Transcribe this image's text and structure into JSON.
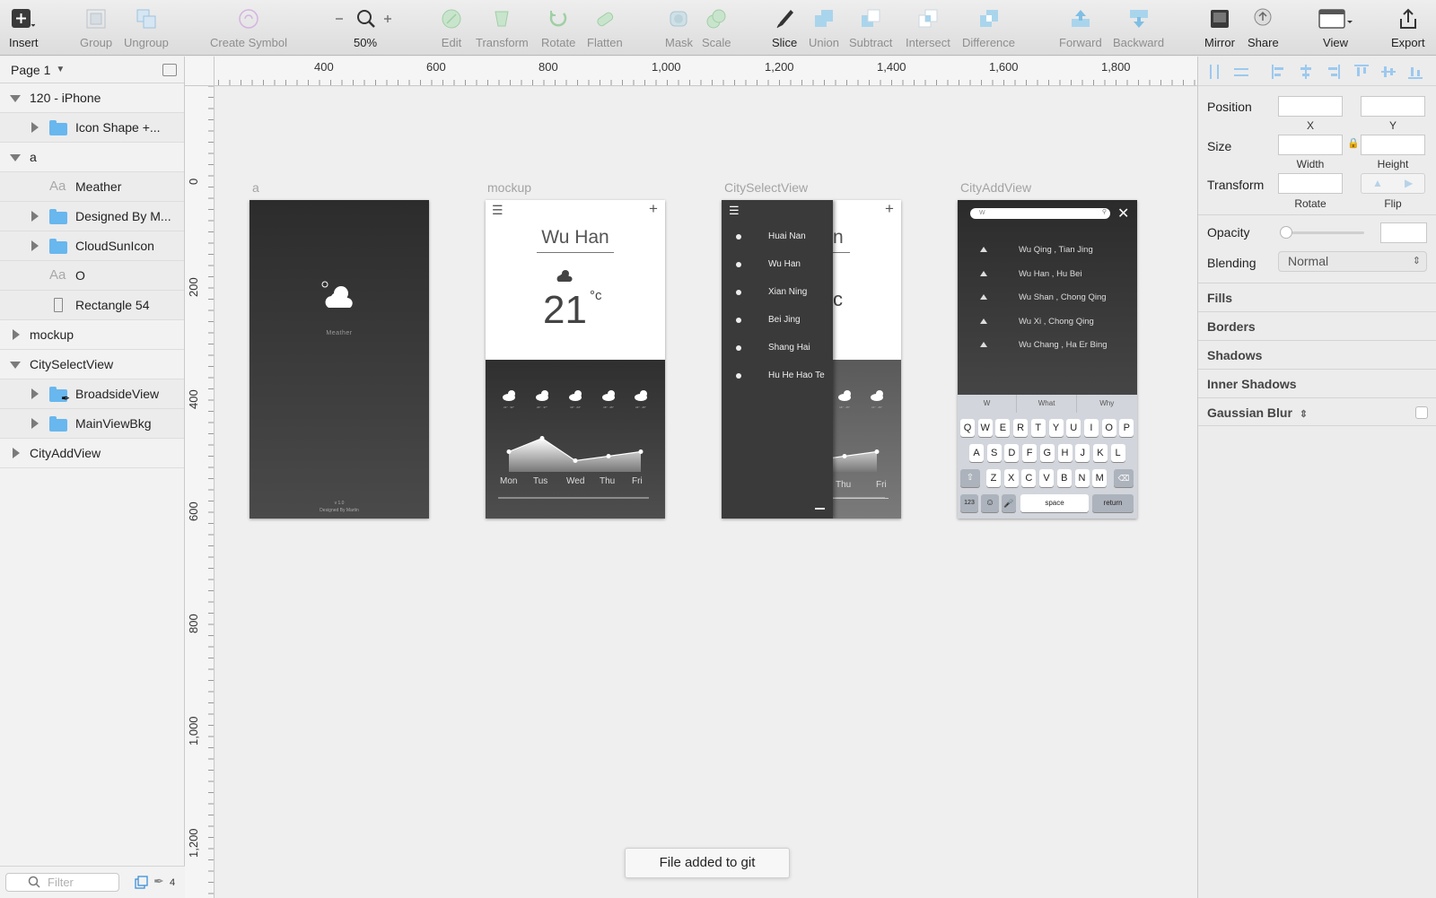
{
  "toolbar": {
    "insert": "Insert",
    "group": "Group",
    "ungroup": "Ungroup",
    "create_symbol": "Create Symbol",
    "zoom": "50%",
    "edit": "Edit",
    "transform": "Transform",
    "rotate": "Rotate",
    "flatten": "Flatten",
    "mask": "Mask",
    "scale": "Scale",
    "slice": "Slice",
    "union": "Union",
    "subtract": "Subtract",
    "intersect": "Intersect",
    "difference": "Difference",
    "forward": "Forward",
    "backward": "Backward",
    "mirror": "Mirror",
    "share": "Share",
    "view": "View",
    "export": "Export"
  },
  "layers_panel": {
    "page": "Page 1",
    "layers": [
      "120 - iPhone",
      "Icon Shape +...",
      "a",
      "Meather",
      "Designed By M...",
      "CloudSunIcon",
      "O",
      "Rectangle 54",
      "mockup",
      "CitySelectView",
      "BroadsideView",
      "MainViewBkg",
      "CityAddView"
    ],
    "filter_placeholder": "Filter",
    "edited_count": "4"
  },
  "rulers": {
    "horizontal": [
      "400",
      "600",
      "800",
      "1,000",
      "1,200",
      "1,400",
      "1,600",
      "1,800"
    ],
    "vertical": [
      "0",
      "200",
      "400",
      "600",
      "800",
      "1,000",
      "1,200"
    ]
  },
  "canvas": {
    "artboards": {
      "a": {
        "title": "a",
        "app_name": "Meather",
        "version": "v 1.0",
        "designer": "Designed By Martin"
      },
      "mockup": {
        "title": "mockup",
        "city": "Wu Han",
        "temperature": "21",
        "unit": "°c",
        "days": [
          "Mon",
          "Tus",
          "Wed",
          "Thu",
          "Fri"
        ],
        "forecast_temps": [
          "21° · 32°",
          "24° · 37°",
          "19° · 24°",
          "16° · 26°",
          "21° · 26°"
        ],
        "trend_levels": [
          0.45,
          0.75,
          0.25,
          0.35,
          0.45
        ]
      },
      "city_select": {
        "title": "CitySelectView",
        "cities": [
          "Huai Nan",
          "Wu Han",
          "Xian Ning",
          "Bei Jing",
          "Shang Hai",
          "Hu He Hao Te"
        ],
        "behind_days": [
          "Thu",
          "Fri"
        ]
      },
      "city_add": {
        "title": "CityAddView",
        "search_value": "W",
        "results": [
          "Wu Qing , Tian Jing",
          "Wu Han , Hu Bei",
          "Wu Shan , Chong Qing",
          "Wu Xi , Chong Qing",
          "Wu Chang , Ha Er Bing"
        ],
        "suggestions": [
          "W",
          "What",
          "Why"
        ],
        "keyboard": {
          "row1": [
            "Q",
            "W",
            "E",
            "R",
            "T",
            "Y",
            "U",
            "I",
            "O",
            "P"
          ],
          "row2": [
            "A",
            "S",
            "D",
            "F",
            "G",
            "H",
            "J",
            "K",
            "L"
          ],
          "row3": [
            "Z",
            "X",
            "C",
            "V",
            "B",
            "N",
            "M"
          ],
          "numbers": "123",
          "space": "space",
          "return": "return"
        }
      }
    },
    "toast": "File added to git"
  },
  "inspector": {
    "position": "Position",
    "x": "X",
    "y": "Y",
    "size": "Size",
    "width": "Width",
    "height": "Height",
    "transform": "Transform",
    "rotate": "Rotate",
    "flip": "Flip",
    "opacity": "Opacity",
    "blending": "Blending",
    "blending_value": "Normal",
    "fills": "Fills",
    "borders": "Borders",
    "shadows": "Shadows",
    "inner_shadows": "Inner Shadows",
    "gaussian_blur": "Gaussian Blur"
  }
}
